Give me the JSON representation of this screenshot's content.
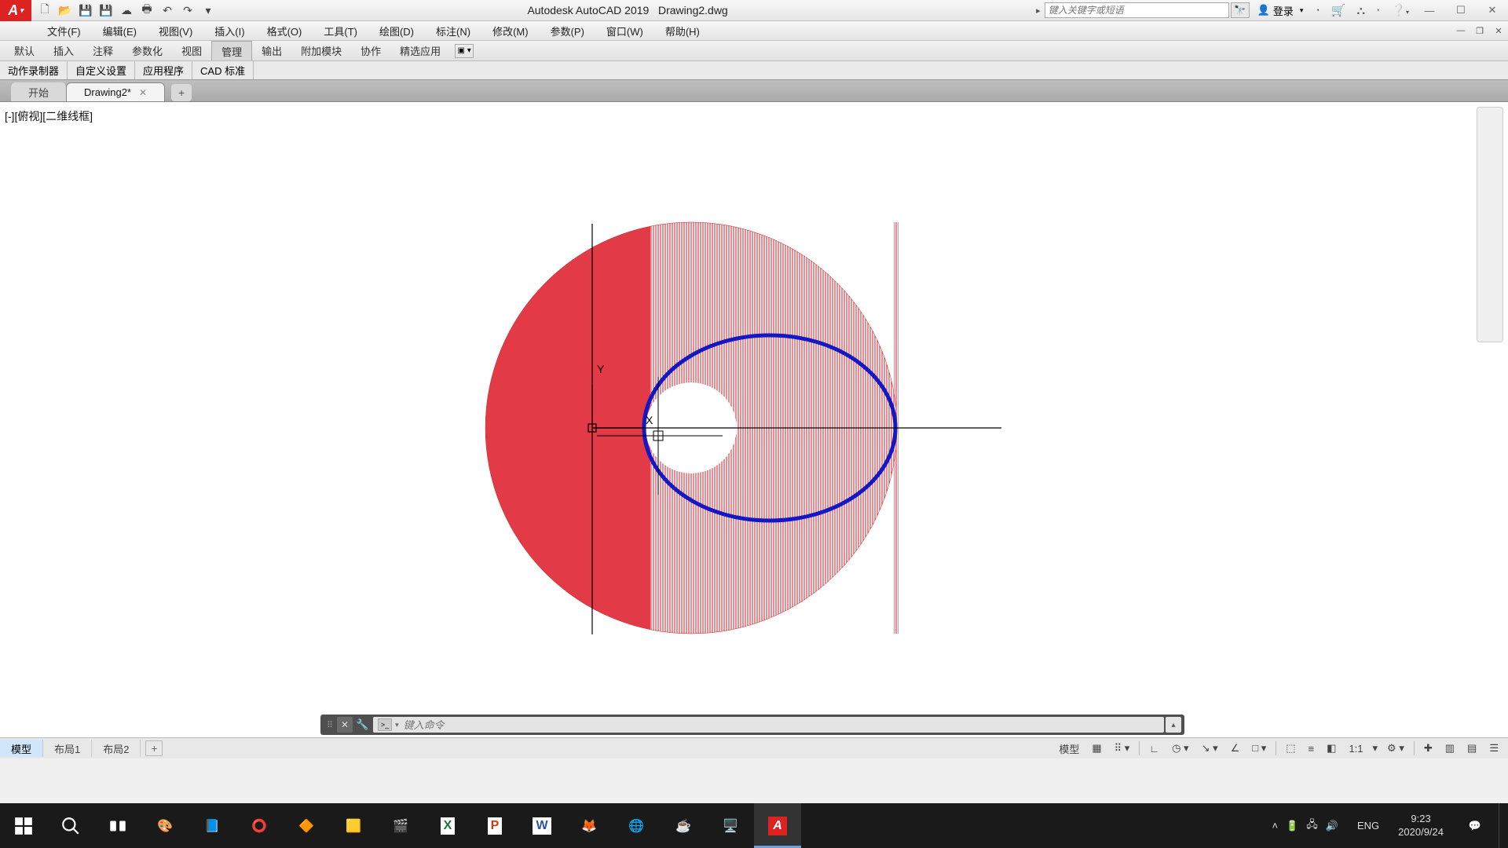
{
  "app": {
    "logo_letter": "A",
    "title_prefix": "Autodesk AutoCAD 2019",
    "title_doc": "Drawing2.dwg",
    "search_placeholder": "键入关键字或短语",
    "login_label": "登录"
  },
  "menus": {
    "file": "文件(F)",
    "edit": "编辑(E)",
    "view": "视图(V)",
    "insert": "插入(I)",
    "format": "格式(O)",
    "tools": "工具(T)",
    "draw": "绘图(D)",
    "dimension": "标注(N)",
    "modify": "修改(M)",
    "parametric": "参数(P)",
    "window": "窗口(W)",
    "help": "帮助(H)"
  },
  "ribbon_tabs": {
    "default": "默认",
    "insert": "插入",
    "annotate": "注释",
    "parametric": "参数化",
    "view": "视图",
    "manage": "管理",
    "output": "输出",
    "addins": "附加模块",
    "collab": "协作",
    "featured": "精选应用"
  },
  "panels": {
    "recorder": "动作录制器",
    "custom": "自定义设置",
    "app": "应用程序",
    "cad_std": "CAD 标准"
  },
  "doc_tabs": {
    "start": "开始",
    "active": "Drawing2*"
  },
  "viewport": {
    "label": "[-][俯视][二维线框]",
    "y_label": "Y",
    "x_label": "X"
  },
  "cmd": {
    "placeholder": "键入命令"
  },
  "layout_tabs": {
    "model": "模型",
    "layout1": "布局1",
    "layout2": "布局2"
  },
  "status": {
    "model": "模型",
    "scale": "1:1"
  },
  "taskbar": {
    "ime": "ENG",
    "time": "9:23",
    "date": "2020/9/24"
  }
}
